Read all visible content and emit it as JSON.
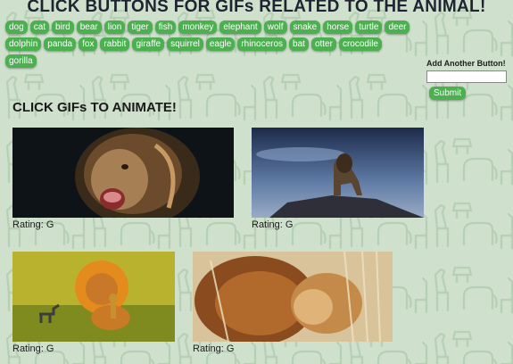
{
  "page": {
    "title": "CLICK BUTTONS FOR GIFs RELATED TO THE ANIMAL!",
    "background_color": "#cfe0cd",
    "pattern_color": "#b7d1b4"
  },
  "animal_buttons": [
    "dog",
    "cat",
    "bird",
    "bear",
    "lion",
    "tiger",
    "fish",
    "monkey",
    "elephant",
    "wolf",
    "snake",
    "horse",
    "turtle",
    "deer",
    "dolphin",
    "panda",
    "fox",
    "rabbit",
    "giraffe",
    "squirrel",
    "eagle",
    "rhinoceros",
    "bat",
    "otter",
    "crocodile",
    "gorilla"
  ],
  "button_color": "#4caf50",
  "add_form": {
    "label": "Add Another Button!",
    "input_value": "",
    "submit_label": "Submit"
  },
  "gif_section": {
    "heading": "CLICK GIFs TO ANIMATE!",
    "rating_label": "Rating:",
    "gifs": [
      {
        "subject": "roaring lion close-up",
        "rating": "G"
      },
      {
        "subject": "lion on rock at night",
        "rating": "G"
      },
      {
        "subject": "fluffy lion cub with toys",
        "rating": "G"
      },
      {
        "subject": "lions nuzzling",
        "rating": "G"
      }
    ]
  }
}
